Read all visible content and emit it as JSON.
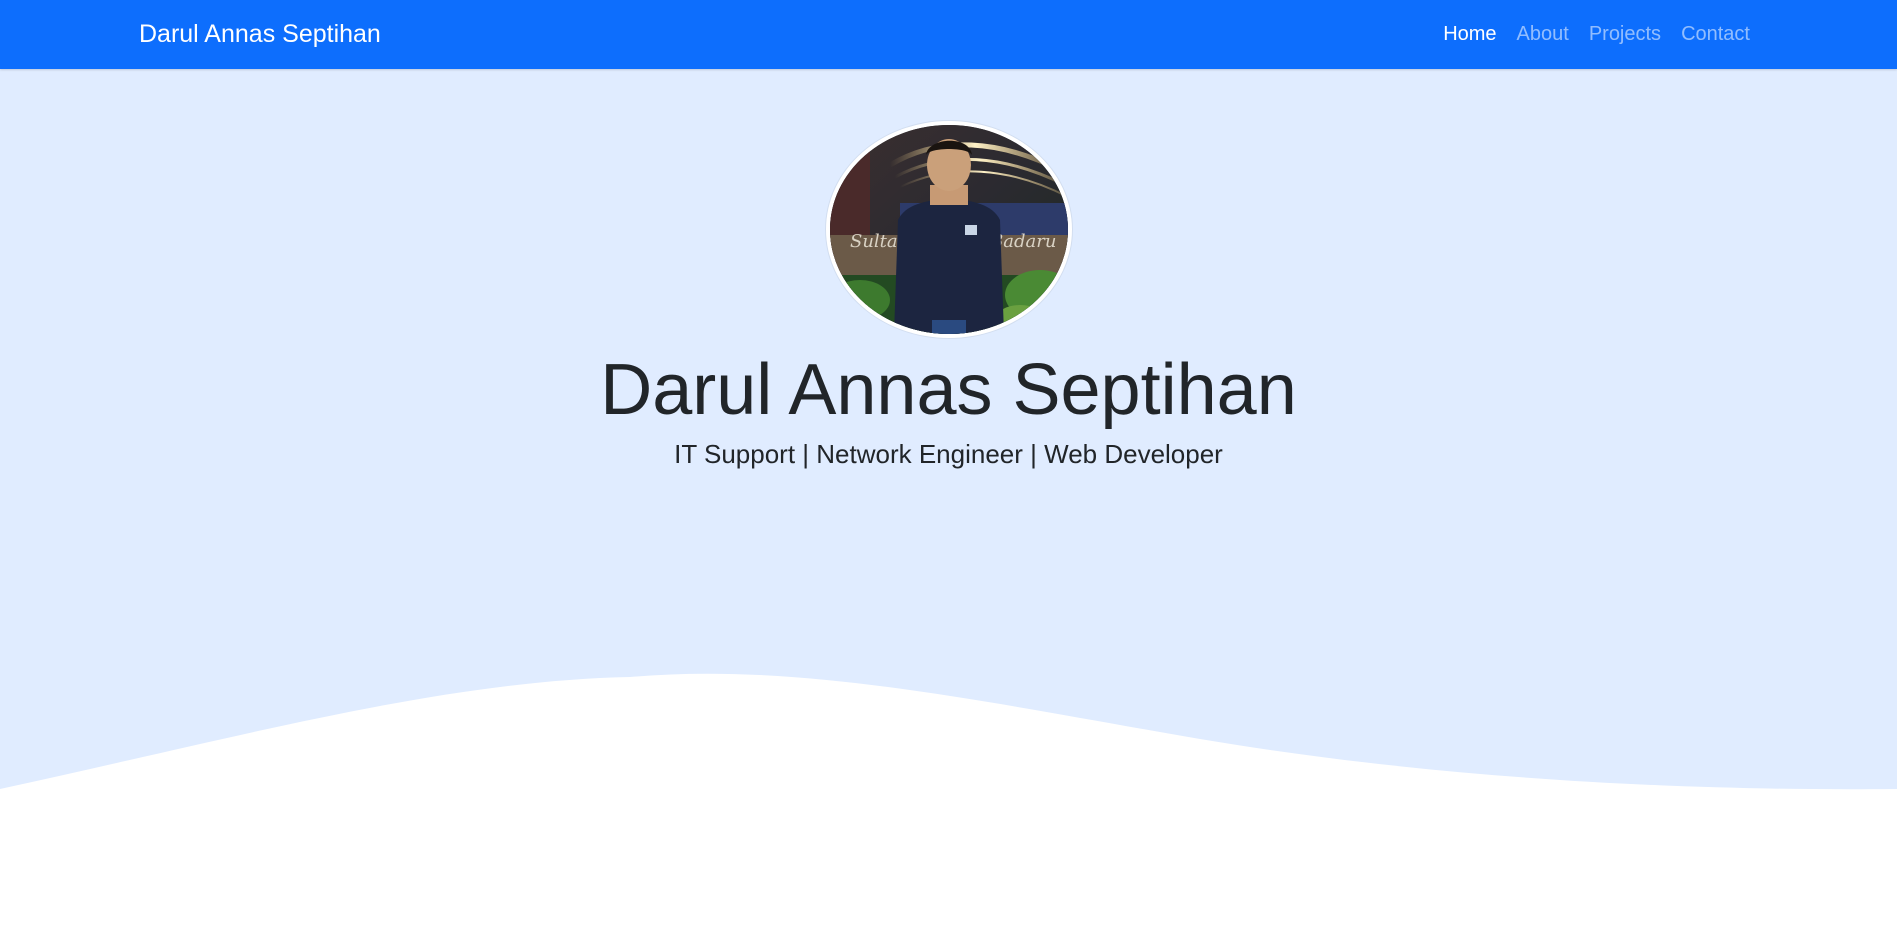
{
  "navbar": {
    "brand": "Darul Annas Septihan",
    "background_color": "#0d6efd",
    "items": [
      {
        "label": "Home",
        "active": true
      },
      {
        "label": "About",
        "active": false
      },
      {
        "label": "Projects",
        "active": false
      },
      {
        "label": "Contact",
        "active": false
      }
    ]
  },
  "hero": {
    "background_color": "#e0ecff",
    "avatar_icon": "profile-photo",
    "name": "Darul Annas Septihan",
    "tagline": "IT Support | Network Engineer | Web Developer"
  }
}
